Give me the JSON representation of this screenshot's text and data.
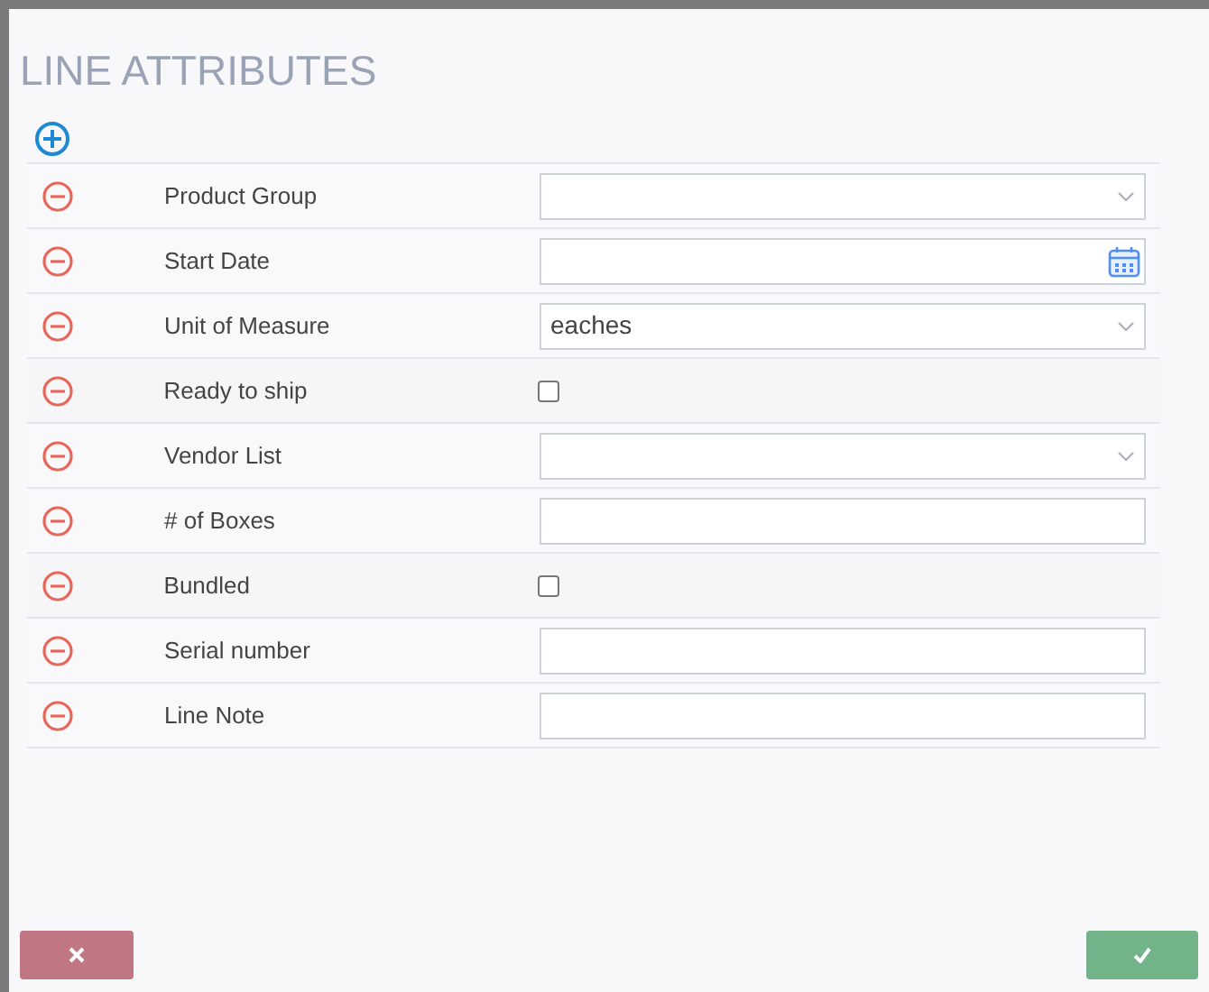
{
  "dialog": {
    "title": "LINE ATTRIBUTES"
  },
  "attributes": [
    {
      "label": "Product Group",
      "kind": "select"
    },
    {
      "label": "Start Date",
      "kind": "date"
    },
    {
      "label": "Unit of Measure",
      "kind": "select",
      "value": "eaches"
    },
    {
      "label": "Ready to ship",
      "kind": "checkbox",
      "checked": false
    },
    {
      "label": "Vendor List",
      "kind": "select"
    },
    {
      "label": "# of Boxes",
      "kind": "text"
    },
    {
      "label": "Bundled",
      "kind": "checkbox",
      "checked": false
    },
    {
      "label": "Serial number",
      "kind": "text"
    },
    {
      "label": "Line Note",
      "kind": "text"
    }
  ],
  "buttons": [
    {
      "kind": "cancel"
    },
    {
      "kind": "confirm"
    }
  ]
}
